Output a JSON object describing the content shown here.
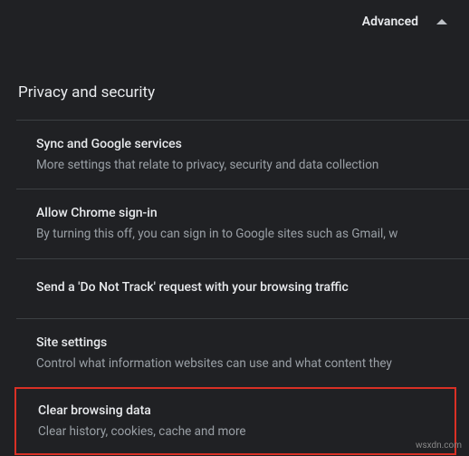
{
  "topbar": {
    "advanced_label": "Advanced"
  },
  "section": {
    "title": "Privacy and security"
  },
  "items": [
    {
      "title": "Sync and Google services",
      "desc": "More settings that relate to privacy, security and data collection"
    },
    {
      "title": "Allow Chrome sign-in",
      "desc": "By turning this off, you can sign in to Google sites such as Gmail, w"
    },
    {
      "title": "Send a 'Do Not Track' request with your browsing traffic",
      "desc": ""
    },
    {
      "title": "Site settings",
      "desc": "Control what information websites can use and what content they"
    },
    {
      "title": "Clear browsing data",
      "desc": "Clear history, cookies, cache and more"
    }
  ],
  "watermark": "wsxdn.com"
}
